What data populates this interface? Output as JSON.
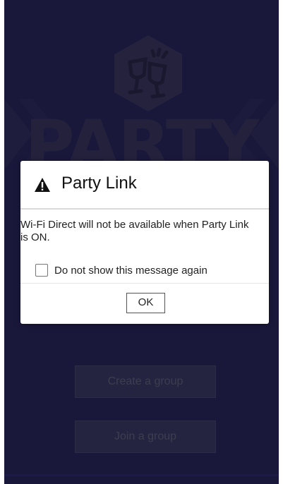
{
  "background": {
    "logo_text": "PARTY",
    "create_group_label": "Create a group",
    "join_group_label": "Join a group"
  },
  "dialog": {
    "icon": "warning-icon",
    "title": "Party Link",
    "message": "Wi-Fi Direct will not be available when Party Link is ON.",
    "checkbox_label": "Do not show this message again",
    "checkbox_checked": false,
    "ok_label": "OK"
  },
  "colors": {
    "app_background": "#2c2a66",
    "ok_border": "#1f5f9f"
  }
}
